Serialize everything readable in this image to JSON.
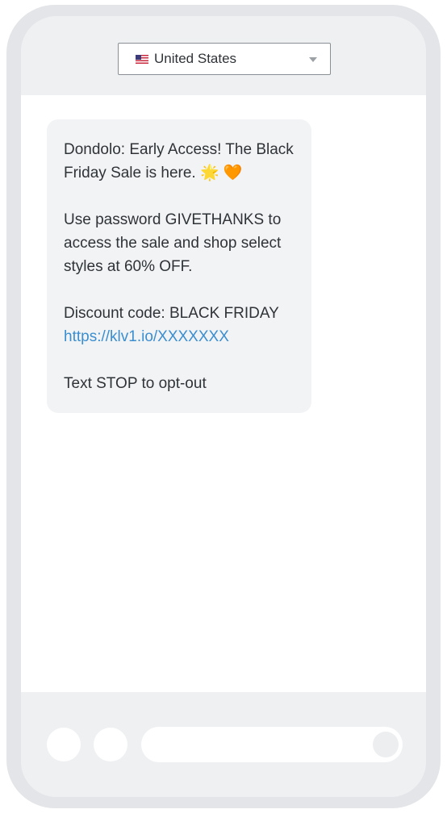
{
  "country_selector": {
    "flag_icon": "us-flag-icon",
    "value": "United States",
    "caret_icon": "triangle-down-icon"
  },
  "message": {
    "line1": "Dondolo: Early Access! The Black Friday Sale is here.",
    "emoji1": "🌟",
    "emoji2": "🧡",
    "paragraph2": "Use password GIVETHANKS to access the sale and shop select styles at 60% OFF.",
    "discount": "Discount code: BLACK FRIDAY",
    "link": "https://klv1.io/XXXXXXX",
    "optout": "Text STOP to opt-out"
  },
  "colors": {
    "link": "#3b8ed0",
    "bubble": "#f2f3f5",
    "frame": "#e3e5e8"
  }
}
